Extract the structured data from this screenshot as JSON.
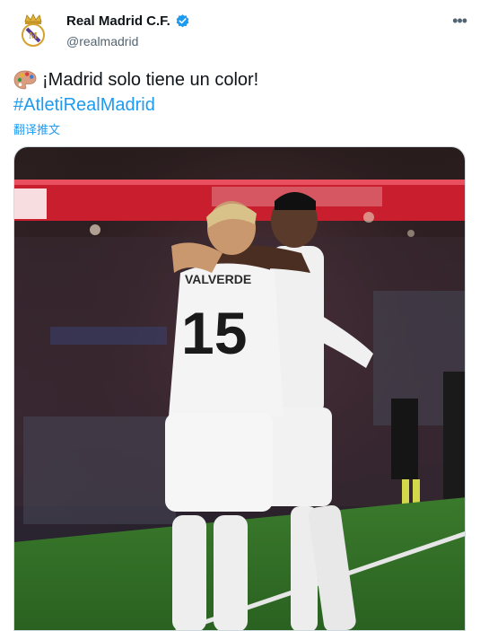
{
  "account": {
    "display_name": "Real Madrid C.F.",
    "handle": "@realmadrid",
    "verified": true,
    "avatar_icon": "real-madrid-crest-icon",
    "verified_icon": "verified-badge-icon",
    "more_icon": "more-options-icon"
  },
  "tweet": {
    "emoji": "artist-palette-emoji",
    "text": "¡Madrid solo tiene un color!",
    "hashtag": "#AtletiRealMadrid",
    "translate_label": "翻译推文"
  },
  "media": {
    "player_front": {
      "number": "15",
      "name": "VALVERDE"
    }
  },
  "colors": {
    "link_blue": "#1d9bf0",
    "secondary_text": "#536471",
    "primary_text": "#0f1419",
    "kit_white": "#f2f2f2"
  }
}
